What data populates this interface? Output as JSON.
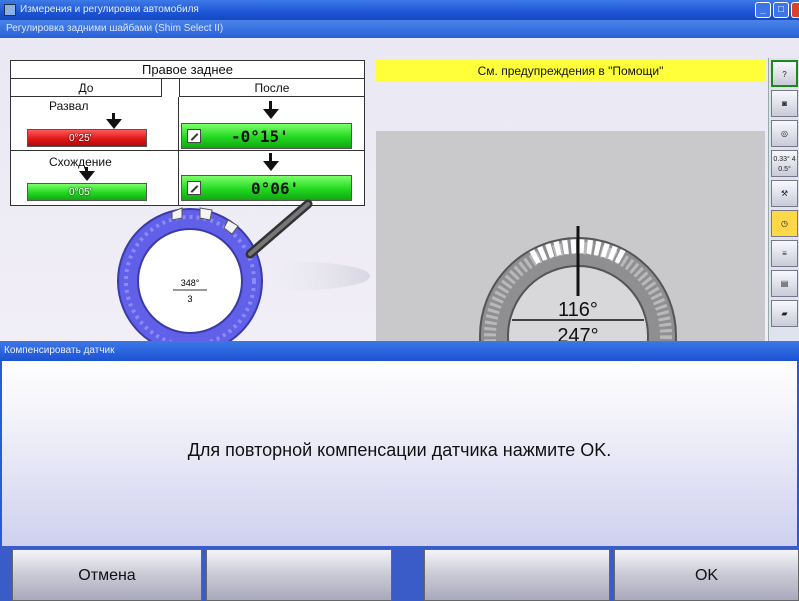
{
  "window": {
    "title": "Измерения и регулировки автомобиля",
    "subtitle": "Регулировка задними шайбами (Shim Select II)",
    "min_glyph": "_",
    "max_glyph": "□",
    "close_glyph": "✕"
  },
  "panel": {
    "header": "Правое заднее",
    "col_before": "До",
    "col_after": "После",
    "rows": [
      {
        "label": "Развал",
        "before": "0°25'",
        "after": "-0°15'",
        "before_status": "red",
        "after_status": "green"
      },
      {
        "label": "Схождение",
        "before": "0°05'",
        "after": "0°06'",
        "before_status": "green",
        "after_status": "green"
      }
    ]
  },
  "shim_dial": {
    "angle": "348°",
    "index": "3"
  },
  "warning": "См. предупреждения в \"Помощи\"",
  "gauge": {
    "top": "116°",
    "bottom": "247°"
  },
  "toolbar": {
    "items": [
      "help-icon",
      "camera-icon",
      "wheel-icon",
      "values-icon",
      "wrench-icon",
      "timer-icon",
      "specs-icon",
      "print-icon",
      "vehicle-icon"
    ],
    "values_text": "0.33° 4 0.5°"
  },
  "dialog": {
    "title": "Компенсировать датчик",
    "message": "Для повторной компенсации датчика нажмите OK.",
    "buttons": {
      "cancel": "Отмена",
      "b2": "",
      "b3": "",
      "ok": "OK"
    }
  },
  "colors": {
    "accent": "#1c55d6",
    "status_red": "#e01818",
    "status_green": "#22d820",
    "warning": "#ffff3a"
  }
}
